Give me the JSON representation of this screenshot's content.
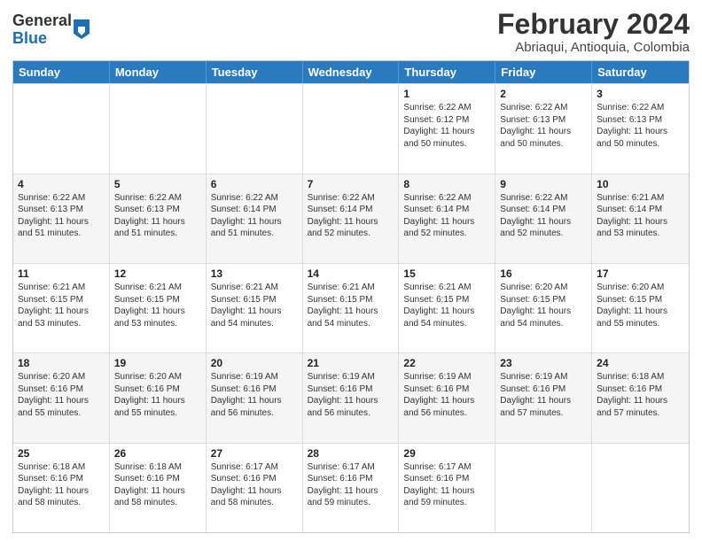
{
  "header": {
    "logo_general": "General",
    "logo_blue": "Blue",
    "month_year": "February 2024",
    "location": "Abriaqui, Antioquia, Colombia"
  },
  "weekdays": [
    "Sunday",
    "Monday",
    "Tuesday",
    "Wednesday",
    "Thursday",
    "Friday",
    "Saturday"
  ],
  "rows": [
    [
      {
        "day": "",
        "info": ""
      },
      {
        "day": "",
        "info": ""
      },
      {
        "day": "",
        "info": ""
      },
      {
        "day": "",
        "info": ""
      },
      {
        "day": "1",
        "info": "Sunrise: 6:22 AM\nSunset: 6:12 PM\nDaylight: 11 hours and 50 minutes."
      },
      {
        "day": "2",
        "info": "Sunrise: 6:22 AM\nSunset: 6:13 PM\nDaylight: 11 hours and 50 minutes."
      },
      {
        "day": "3",
        "info": "Sunrise: 6:22 AM\nSunset: 6:13 PM\nDaylight: 11 hours and 50 minutes."
      }
    ],
    [
      {
        "day": "4",
        "info": "Sunrise: 6:22 AM\nSunset: 6:13 PM\nDaylight: 11 hours and 51 minutes."
      },
      {
        "day": "5",
        "info": "Sunrise: 6:22 AM\nSunset: 6:13 PM\nDaylight: 11 hours and 51 minutes."
      },
      {
        "day": "6",
        "info": "Sunrise: 6:22 AM\nSunset: 6:14 PM\nDaylight: 11 hours and 51 minutes."
      },
      {
        "day": "7",
        "info": "Sunrise: 6:22 AM\nSunset: 6:14 PM\nDaylight: 11 hours and 52 minutes."
      },
      {
        "day": "8",
        "info": "Sunrise: 6:22 AM\nSunset: 6:14 PM\nDaylight: 11 hours and 52 minutes."
      },
      {
        "day": "9",
        "info": "Sunrise: 6:22 AM\nSunset: 6:14 PM\nDaylight: 11 hours and 52 minutes."
      },
      {
        "day": "10",
        "info": "Sunrise: 6:21 AM\nSunset: 6:14 PM\nDaylight: 11 hours and 53 minutes."
      }
    ],
    [
      {
        "day": "11",
        "info": "Sunrise: 6:21 AM\nSunset: 6:15 PM\nDaylight: 11 hours and 53 minutes."
      },
      {
        "day": "12",
        "info": "Sunrise: 6:21 AM\nSunset: 6:15 PM\nDaylight: 11 hours and 53 minutes."
      },
      {
        "day": "13",
        "info": "Sunrise: 6:21 AM\nSunset: 6:15 PM\nDaylight: 11 hours and 54 minutes."
      },
      {
        "day": "14",
        "info": "Sunrise: 6:21 AM\nSunset: 6:15 PM\nDaylight: 11 hours and 54 minutes."
      },
      {
        "day": "15",
        "info": "Sunrise: 6:21 AM\nSunset: 6:15 PM\nDaylight: 11 hours and 54 minutes."
      },
      {
        "day": "16",
        "info": "Sunrise: 6:20 AM\nSunset: 6:15 PM\nDaylight: 11 hours and 54 minutes."
      },
      {
        "day": "17",
        "info": "Sunrise: 6:20 AM\nSunset: 6:15 PM\nDaylight: 11 hours and 55 minutes."
      }
    ],
    [
      {
        "day": "18",
        "info": "Sunrise: 6:20 AM\nSunset: 6:16 PM\nDaylight: 11 hours and 55 minutes."
      },
      {
        "day": "19",
        "info": "Sunrise: 6:20 AM\nSunset: 6:16 PM\nDaylight: 11 hours and 55 minutes."
      },
      {
        "day": "20",
        "info": "Sunrise: 6:19 AM\nSunset: 6:16 PM\nDaylight: 11 hours and 56 minutes."
      },
      {
        "day": "21",
        "info": "Sunrise: 6:19 AM\nSunset: 6:16 PM\nDaylight: 11 hours and 56 minutes."
      },
      {
        "day": "22",
        "info": "Sunrise: 6:19 AM\nSunset: 6:16 PM\nDaylight: 11 hours and 56 minutes."
      },
      {
        "day": "23",
        "info": "Sunrise: 6:19 AM\nSunset: 6:16 PM\nDaylight: 11 hours and 57 minutes."
      },
      {
        "day": "24",
        "info": "Sunrise: 6:18 AM\nSunset: 6:16 PM\nDaylight: 11 hours and 57 minutes."
      }
    ],
    [
      {
        "day": "25",
        "info": "Sunrise: 6:18 AM\nSunset: 6:16 PM\nDaylight: 11 hours and 58 minutes."
      },
      {
        "day": "26",
        "info": "Sunrise: 6:18 AM\nSunset: 6:16 PM\nDaylight: 11 hours and 58 minutes."
      },
      {
        "day": "27",
        "info": "Sunrise: 6:17 AM\nSunset: 6:16 PM\nDaylight: 11 hours and 58 minutes."
      },
      {
        "day": "28",
        "info": "Sunrise: 6:17 AM\nSunset: 6:16 PM\nDaylight: 11 hours and 59 minutes."
      },
      {
        "day": "29",
        "info": "Sunrise: 6:17 AM\nSunset: 6:16 PM\nDaylight: 11 hours and 59 minutes."
      },
      {
        "day": "",
        "info": ""
      },
      {
        "day": "",
        "info": ""
      }
    ]
  ]
}
